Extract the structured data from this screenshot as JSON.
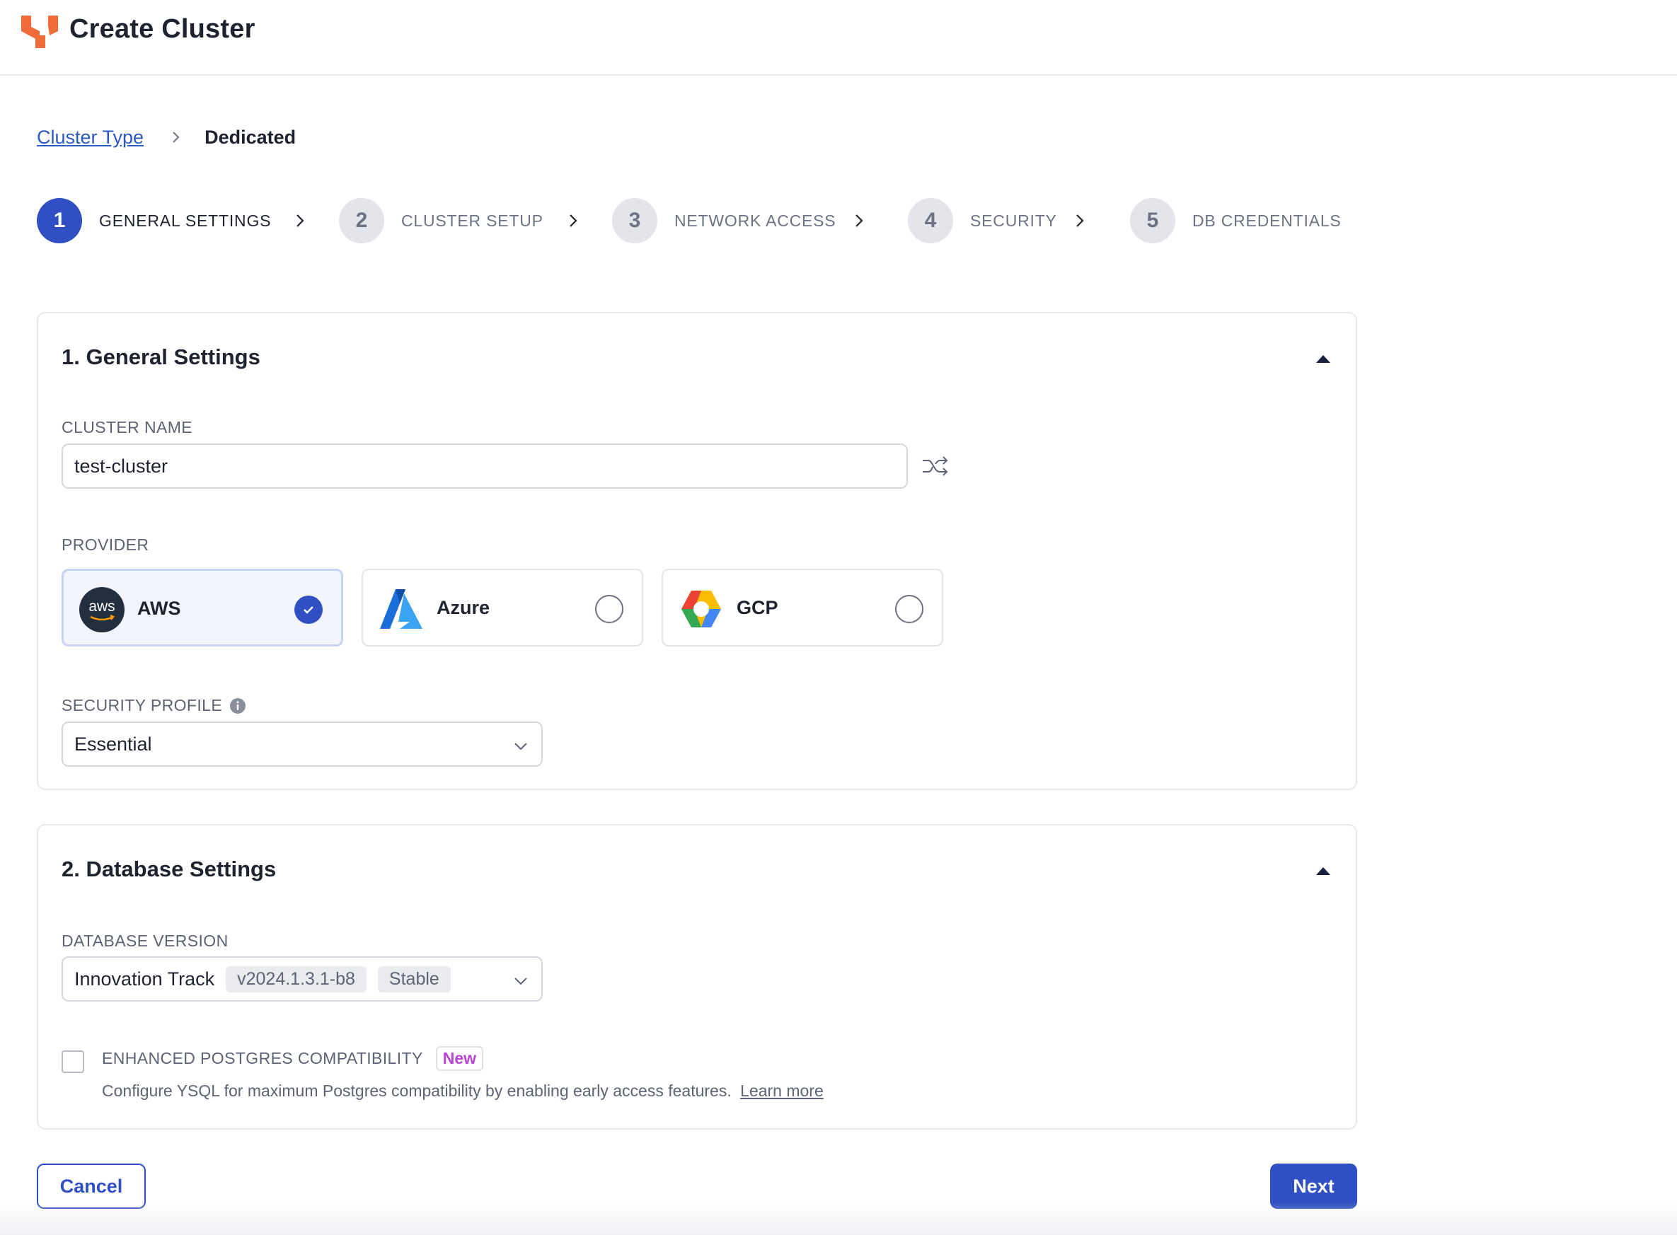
{
  "header": {
    "title": "Create Cluster"
  },
  "breadcrumb": {
    "parent": "Cluster Type",
    "current": "Dedicated"
  },
  "steps": [
    {
      "number": "1",
      "label": "GENERAL SETTINGS",
      "active": true
    },
    {
      "number": "2",
      "label": "CLUSTER SETUP",
      "active": false
    },
    {
      "number": "3",
      "label": "NETWORK ACCESS",
      "active": false
    },
    {
      "number": "4",
      "label": "SECURITY",
      "active": false
    },
    {
      "number": "5",
      "label": "DB CREDENTIALS",
      "active": false
    }
  ],
  "general": {
    "title": "1. General Settings",
    "cluster_name_label": "CLUSTER NAME",
    "cluster_name_value": "test-cluster",
    "provider_label": "PROVIDER",
    "providers": [
      {
        "name": "AWS",
        "logo_text": "aws",
        "selected": true
      },
      {
        "name": "Azure",
        "selected": false
      },
      {
        "name": "GCP",
        "selected": false
      }
    ],
    "security_profile_label": "SECURITY PROFILE",
    "security_profile_value": "Essential"
  },
  "database": {
    "title": "2. Database Settings",
    "version_label": "DATABASE VERSION",
    "version_track": "Innovation Track",
    "version_tag": "v2024.1.3.1-b8",
    "version_status": "Stable",
    "pg_compat_label": "ENHANCED POSTGRES COMPATIBILITY",
    "pg_compat_badge": "New",
    "pg_compat_checked": false,
    "pg_compat_desc": "Configure YSQL for maximum Postgres compatibility by enabling early access features.",
    "learn_more": "Learn more"
  },
  "actions": {
    "cancel": "Cancel",
    "next": "Next"
  },
  "colors": {
    "primary": "#2f4fc2",
    "brand": "#ef6b3a",
    "link": "#2b59c3",
    "badge_new": "#b844d8"
  }
}
